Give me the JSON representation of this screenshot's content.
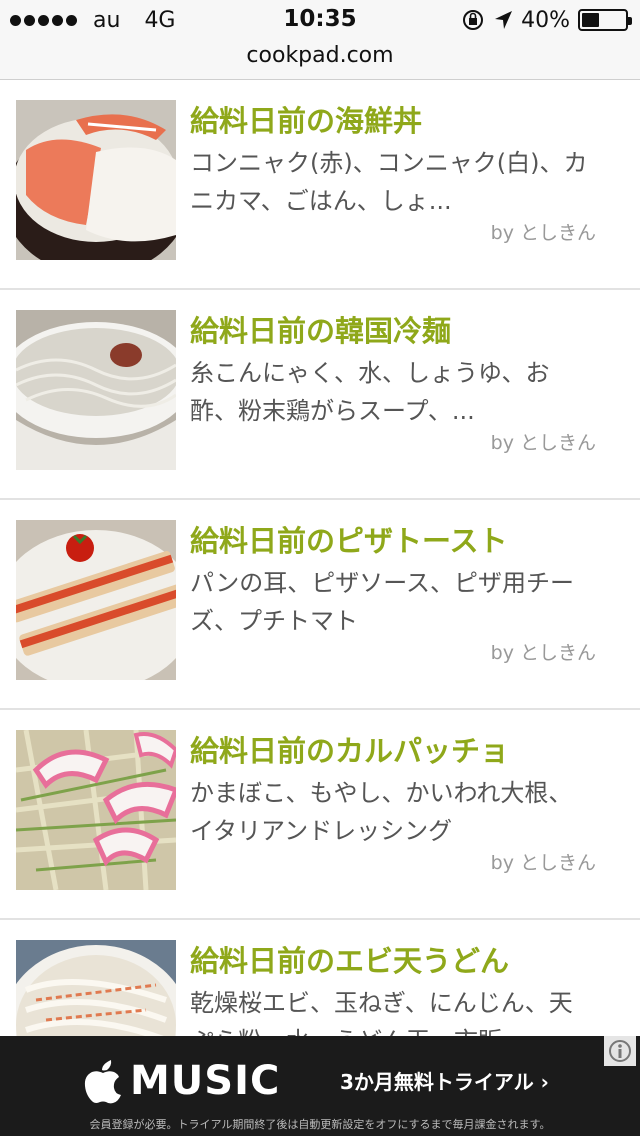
{
  "status_bar": {
    "carrier": "au",
    "network": "4G",
    "time": "10:35",
    "battery_text": "40%",
    "battery_level": 0.4
  },
  "url_bar": {
    "domain": "cookpad.com"
  },
  "recipes": [
    {
      "title": "給料日前の海鮮丼",
      "ingredients": "コンニャク(赤)、コンニャク(白)、カニカマ、ごはん、しょ...",
      "author": "by としきん"
    },
    {
      "title": "給料日前の韓国冷麺",
      "ingredients": "糸こんにゃく、水、しょうゆ、お酢、粉末鶏がらスープ、...",
      "author": "by としきん"
    },
    {
      "title": "給料日前のピザトースト",
      "ingredients": "パンの耳、ピザソース、ピザ用チーズ、プチトマト",
      "author": "by としきん"
    },
    {
      "title": "給料日前のカルパッチョ",
      "ingredients": "かまぼこ、もやし、かいわれ大根、イタリアンドレッシング",
      "author": "by としきん"
    },
    {
      "title": "給料日前のエビ天うどん",
      "ingredients": "乾燥桜エビ、玉ねぎ、にんじん、天ぷら粉、水、うどん玉、市販",
      "author": ""
    }
  ],
  "ad": {
    "brand": "MUSIC",
    "cta": "3か月無料トライアル ›",
    "fine_print": "会員登録が必要。トライアル期間終了後は自動更新設定をオフにするまで毎月課金されます。",
    "icons": [
      "apple-logo-icon",
      "info-icon"
    ]
  },
  "colors": {
    "title_green": "#8fa81a",
    "ingredient_gray": "#555555",
    "author_gray": "#999999",
    "ad_bg": "#1b1b1b"
  }
}
